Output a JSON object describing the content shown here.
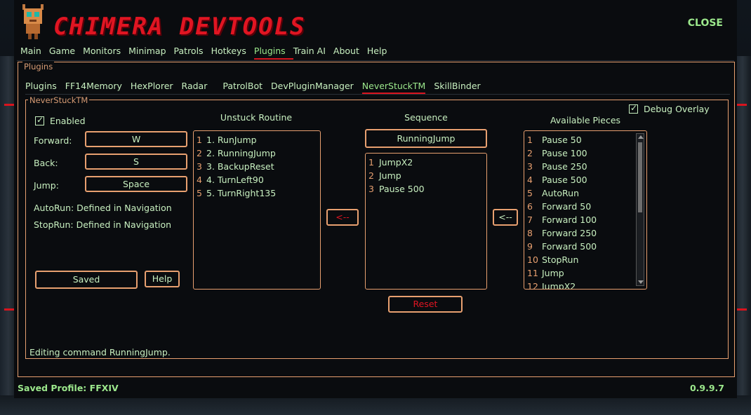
{
  "app": {
    "title": "CHIMERA DEVTOOLS",
    "close_label": "CLOSE"
  },
  "menu": [
    "Main",
    "Game",
    "Monitors",
    "Minimap",
    "Patrols",
    "Hotkeys",
    "Plugins",
    "Train AI",
    "About",
    "Help"
  ],
  "menu_active": "Plugins",
  "plugins_group_label": "Plugins",
  "tabs": [
    "Plugins",
    "FF14Memory",
    "HexPlorer",
    "Radar",
    "PatrolBot",
    "DevPluginManager",
    "NeverStuckTM",
    "SkillBinder"
  ],
  "tabs_active": "NeverStuckTM",
  "panel": {
    "group_label": "NeverStuckTM",
    "enabled_label": "Enabled",
    "debug_overlay_label": "Debug Overlay",
    "forward_label": "Forward:",
    "forward_value": "W",
    "back_label": "Back:",
    "back_value": "S",
    "jump_label": "Jump:",
    "jump_value": "Space",
    "autorun_text": "AutoRun: Defined in Navigation",
    "stoprun_text": "StopRun: Defined in Navigation",
    "saved_label": "Saved",
    "help_label": "Help",
    "status_text": "Editing command RunningJump."
  },
  "unstuck": {
    "title": "Unstuck Routine",
    "items": [
      {
        "n": "1",
        "label": "1. RunJump"
      },
      {
        "n": "2",
        "label": "2. RunningJump"
      },
      {
        "n": "3",
        "label": "3. BackupReset"
      },
      {
        "n": "4",
        "label": "4. TurnLeft90"
      },
      {
        "n": "5",
        "label": "5. TurnRight135"
      }
    ]
  },
  "sequence": {
    "title": "Sequence",
    "name": "RunningJump",
    "items": [
      {
        "n": "1",
        "label": "JumpX2"
      },
      {
        "n": "2",
        "label": "Jump"
      },
      {
        "n": "3",
        "label": "Pause 500"
      }
    ],
    "move_left_label": "<--",
    "reset_label": "Reset"
  },
  "pieces": {
    "title": "Available Pieces",
    "move_left_label": "<--",
    "items": [
      {
        "n": "1",
        "label": "Pause 50"
      },
      {
        "n": "2",
        "label": "Pause 100"
      },
      {
        "n": "3",
        "label": "Pause 250"
      },
      {
        "n": "4",
        "label": "Pause 500"
      },
      {
        "n": "5",
        "label": "AutoRun"
      },
      {
        "n": "6",
        "label": "Forward 50"
      },
      {
        "n": "7",
        "label": "Forward 100"
      },
      {
        "n": "8",
        "label": "Forward 250"
      },
      {
        "n": "9",
        "label": "Forward 500"
      },
      {
        "n": "10",
        "label": "StopRun"
      },
      {
        "n": "11",
        "label": "Jump"
      },
      {
        "n": "12",
        "label": "JumpX2"
      }
    ]
  },
  "footer": {
    "profile": "Saved Profile: FFXIV",
    "version": "0.9.9.7"
  },
  "colors": {
    "accent_orange": "#e8a070",
    "accent_red": "#e01522",
    "text_green": "#c8f0c0"
  }
}
